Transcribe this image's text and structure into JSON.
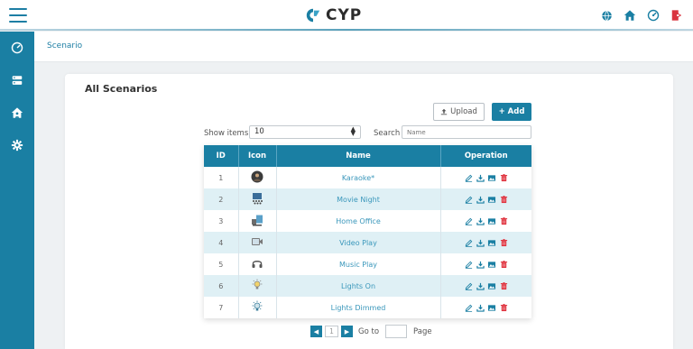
{
  "header": {
    "logo_text": "CYP",
    "accent_color": "#1a7fa3",
    "icons": [
      "globe-icon",
      "home-icon",
      "dashboard-gauge-icon",
      "logout-icon"
    ]
  },
  "sidebar": {
    "items": [
      {
        "icon": "dashboard-gauge-icon"
      },
      {
        "icon": "server-icon"
      },
      {
        "icon": "home-user-icon"
      },
      {
        "icon": "gear-icon"
      }
    ]
  },
  "breadcrumb": {
    "current": "Scenario"
  },
  "card": {
    "title": "All Scenarios",
    "upload_label": "Upload",
    "add_label": "+ Add"
  },
  "controls": {
    "show_items_label": "Show items",
    "show_items_value": "10",
    "search_label": "Search",
    "search_placeholder": "Name"
  },
  "table": {
    "headers": {
      "id": "ID",
      "icon": "Icon",
      "name": "Name",
      "operation": "Operation"
    },
    "rows": [
      {
        "id": "1",
        "icon": "karaoke-photo-icon",
        "name": "Karaoke*"
      },
      {
        "id": "2",
        "icon": "movie-screen-icon",
        "name": "Movie Night"
      },
      {
        "id": "3",
        "icon": "home-office-icon",
        "name": "Home Office"
      },
      {
        "id": "4",
        "icon": "video-play-icon",
        "name": "Video Play"
      },
      {
        "id": "5",
        "icon": "headphones-icon",
        "name": "Music Play"
      },
      {
        "id": "6",
        "icon": "bulb-on-icon",
        "name": "Lights On"
      },
      {
        "id": "7",
        "icon": "bulb-dimmed-icon",
        "name": "Lights Dimmed"
      }
    ],
    "operations": [
      "edit-icon",
      "download-icon",
      "image-icon",
      "trash-icon"
    ]
  },
  "pager": {
    "current_page": "1",
    "goto_label": "Go to",
    "page_label": "Page"
  }
}
